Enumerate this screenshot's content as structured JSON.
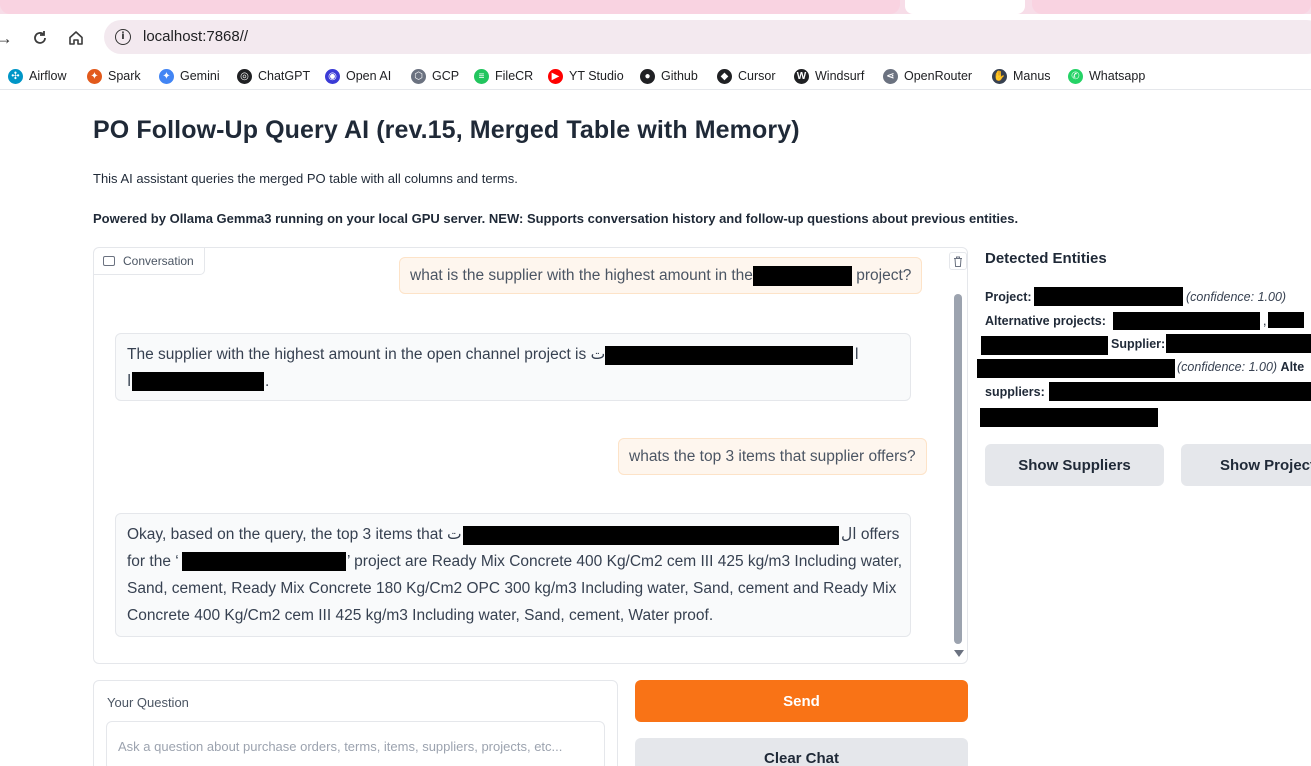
{
  "browser": {
    "url": "localhost:7868//",
    "bookmarks": [
      {
        "label": "Airflow",
        "icon": "airflow-icon",
        "color": "#0096c7"
      },
      {
        "label": "Spark",
        "icon": "spark-icon",
        "color": "#e25a1c"
      },
      {
        "label": "Gemini",
        "icon": "gemini-icon",
        "color": "#4285f4"
      },
      {
        "label": "ChatGPT",
        "icon": "chatgpt-icon",
        "color": "#202124"
      },
      {
        "label": "Open AI",
        "icon": "openai-icon",
        "color": "#3b3bd6"
      },
      {
        "label": "GCP",
        "icon": "gcp-icon",
        "color": "#6b7280"
      },
      {
        "label": "FileCR",
        "icon": "filecr-icon",
        "color": "#22c55e"
      },
      {
        "label": "YT Studio",
        "icon": "youtube-icon",
        "color": "#ff0000"
      },
      {
        "label": "Github",
        "icon": "github-icon",
        "color": "#202124"
      },
      {
        "label": "Cursor",
        "icon": "cursor-icon",
        "color": "#202124"
      },
      {
        "label": "Windsurf",
        "icon": "windsurf-icon",
        "color": "#202124"
      },
      {
        "label": "OpenRouter",
        "icon": "openrouter-icon",
        "color": "#6b7280"
      },
      {
        "label": "Manus",
        "icon": "manus-icon",
        "color": "#374151"
      },
      {
        "label": "Whatsapp",
        "icon": "whatsapp-icon",
        "color": "#25d366"
      }
    ]
  },
  "page": {
    "title": "PO Follow-Up Query AI (rev.15, Merged Table with Memory)",
    "description": "This AI assistant queries the merged PO table with all columns and terms.",
    "powered_by": "Powered by Ollama Gemma3 running on your local GPU server. NEW: Supports conversation history and follow-up questions about previous entities."
  },
  "chat": {
    "label": "Conversation",
    "messages": [
      {
        "role": "user",
        "pre": "what is the supplier with the highest amount in the",
        "post": "project?"
      },
      {
        "role": "bot",
        "pre": "The supplier with the highest amount in the open channel project is ت",
        "mid": "ا",
        "post": "."
      },
      {
        "role": "user",
        "text": "whats the top 3 items that supplier offers?"
      },
      {
        "role": "bot",
        "pre": "Okay, based on the query, the top 3 items that ت",
        "mid": "ال offers",
        "mid2": "for the ‘",
        "post": "’ project are Ready Mix Concrete 400 Kg/Cm2 cem III 425 kg/m3 Including water, Sand, cement, Ready Mix Concrete 180 Kg/Cm2 OPC 300 kg/m3 Including water, Sand, cement and Ready Mix Concrete 400 Kg/Cm2 cem III 425 kg/m3 Including water, Sand, cement, Water proof."
      }
    ]
  },
  "entities": {
    "title": "Detected Entities",
    "project_label": "Project:",
    "confidence_1": "(confidence: 1.00)",
    "alt_projects_label": "Alternative projects:",
    "comma": ",",
    "supplier_label": "Supplier:",
    "confidence_2": "(confidence: 1.00)",
    "alt_suppliers_label_a": "Alte",
    "alt_suppliers_label_b": "suppliers:",
    "show_suppliers": "Show Suppliers",
    "show_projects": "Show Project"
  },
  "input": {
    "label": "Your Question",
    "placeholder": "Ask a question about purchase orders, terms, items, suppliers, projects, etc...",
    "send": "Send",
    "clear": "Clear Chat"
  }
}
